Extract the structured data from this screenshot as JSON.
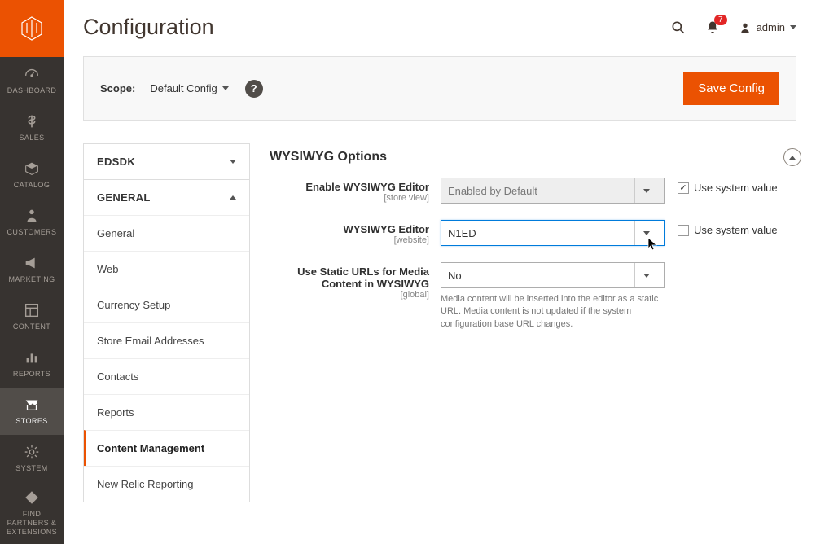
{
  "page_title": "Configuration",
  "topbar": {
    "notification_count": "7",
    "admin_label": "admin"
  },
  "scopebar": {
    "label": "Scope:",
    "value": "Default Config",
    "save_label": "Save Config"
  },
  "leftnav": [
    {
      "key": "dashboard",
      "label": "DASHBOARD"
    },
    {
      "key": "sales",
      "label": "SALES"
    },
    {
      "key": "catalog",
      "label": "CATALOG"
    },
    {
      "key": "customers",
      "label": "CUSTOMERS"
    },
    {
      "key": "marketing",
      "label": "MARKETING"
    },
    {
      "key": "content",
      "label": "CONTENT"
    },
    {
      "key": "reports",
      "label": "REPORTS"
    },
    {
      "key": "stores",
      "label": "STORES"
    },
    {
      "key": "system",
      "label": "SYSTEM"
    },
    {
      "key": "partners",
      "label": "FIND PARTNERS & EXTENSIONS"
    }
  ],
  "sidebar": {
    "sections": [
      {
        "key": "edsdk",
        "label": "EDSDK",
        "expanded": false
      },
      {
        "key": "general",
        "label": "GENERAL",
        "expanded": true
      }
    ],
    "general_items": [
      {
        "key": "general",
        "label": "General"
      },
      {
        "key": "web",
        "label": "Web"
      },
      {
        "key": "currency",
        "label": "Currency Setup"
      },
      {
        "key": "store_email",
        "label": "Store Email Addresses"
      },
      {
        "key": "contacts",
        "label": "Contacts"
      },
      {
        "key": "reports",
        "label": "Reports"
      },
      {
        "key": "content_management",
        "label": "Content Management",
        "selected": true
      },
      {
        "key": "newrelic",
        "label": "New Relic Reporting"
      }
    ]
  },
  "section": {
    "title": "WYSIWYG Options",
    "rows": {
      "enable": {
        "label": "Enable WYSIWYG Editor",
        "scope": "[store view]",
        "value": "Enabled by Default",
        "use_system": "Use system value",
        "use_system_checked": true
      },
      "editor": {
        "label": "WYSIWYG Editor",
        "scope": "[website]",
        "value": "N1ED",
        "use_system": "Use system value",
        "use_system_checked": false
      },
      "static": {
        "label": "Use Static URLs for Media Content in WYSIWYG",
        "scope": "[global]",
        "value": "No",
        "hint": "Media content will be inserted into the editor as a static URL. Media content is not updated if the system configuration base URL changes."
      }
    }
  }
}
